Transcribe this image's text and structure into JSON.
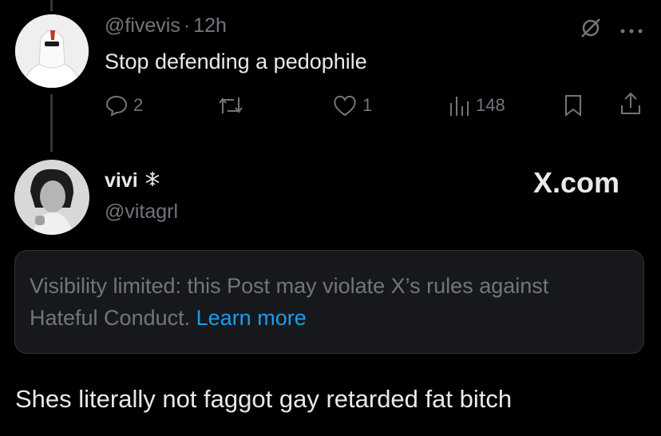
{
  "post1": {
    "handle": "@fivevis",
    "separator": "·",
    "time": "12h",
    "text": "Stop defending a pedophile",
    "actions": {
      "replies": "2",
      "likes": "1",
      "views": "148"
    }
  },
  "post2": {
    "display_name": "vivi",
    "badge_icon": "snowflake-icon",
    "handle": "@vitagrl",
    "watermark": "X.com",
    "notice": {
      "text": "Visibility limited: this Post may violate X’s rules against Hateful Conduct.",
      "link": "Learn more"
    },
    "text": "Shes literally not faggot gay retarded fat bitch"
  },
  "colors": {
    "background": "#000000",
    "text": "#e7e9ea",
    "muted": "#71767b",
    "link": "#1d9bf0"
  }
}
